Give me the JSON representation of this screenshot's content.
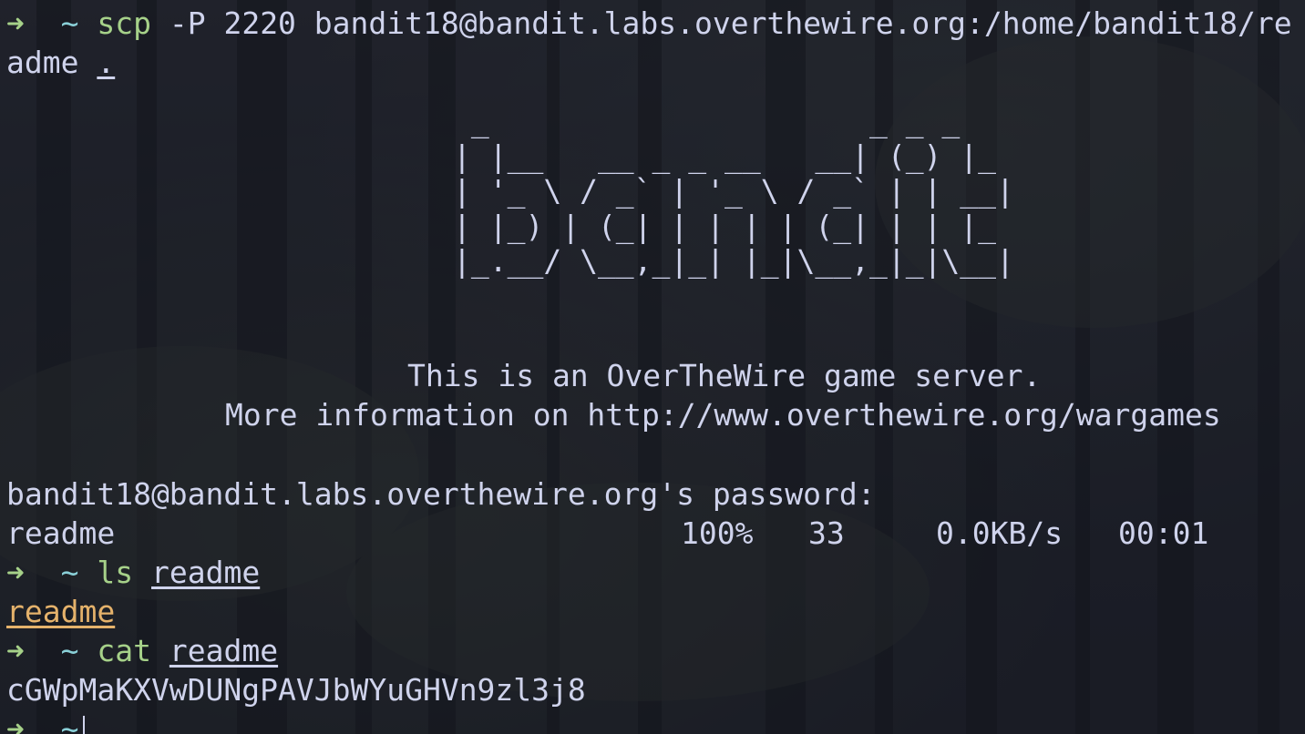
{
  "prompt": {
    "arrow": "➜",
    "cwd": "~"
  },
  "cmd1": {
    "program": "scp",
    "args": " -P 2220 bandit18@bandit.labs.overthewire.org:/home/bandit18/re",
    "args_wrap": "adme ",
    "dest": "."
  },
  "banner": {
    "ascii": [
      " _                     _ _ _   ",
      "| |__   __ _ _ __   __| (_) |_ ",
      "| '_ \\ / _` | '_ \\ / _` | | __|",
      "| |_) | (_| | | | | (_| | | |_ ",
      "|_.__/ \\__,_|_| |_|\\__,_|_|\\__|"
    ],
    "line1": "This is an OverTheWire game server.",
    "line2": "More information on http://www.overthewire.org/wargames"
  },
  "password_prompt": "bandit18@bandit.labs.overthewire.org's password:",
  "transfer": {
    "file": "readme",
    "percent": "100%",
    "size": "33",
    "rate": "0.0KB/s",
    "time": "00:01"
  },
  "cmd2": {
    "program": "ls",
    "arg": "readme"
  },
  "ls_output": "readme",
  "cmd3": {
    "program": "cat",
    "arg": "readme"
  },
  "cat_output": "cGWpMaKXVwDUNgPAVJbWYuGHVn9zl3j8",
  "colors": {
    "arrow": "#a6d189",
    "cwd": "#8ad0d8",
    "command": "#a6d189",
    "text": "#cfd3ec",
    "highlighted_file": "#e5b26b"
  }
}
